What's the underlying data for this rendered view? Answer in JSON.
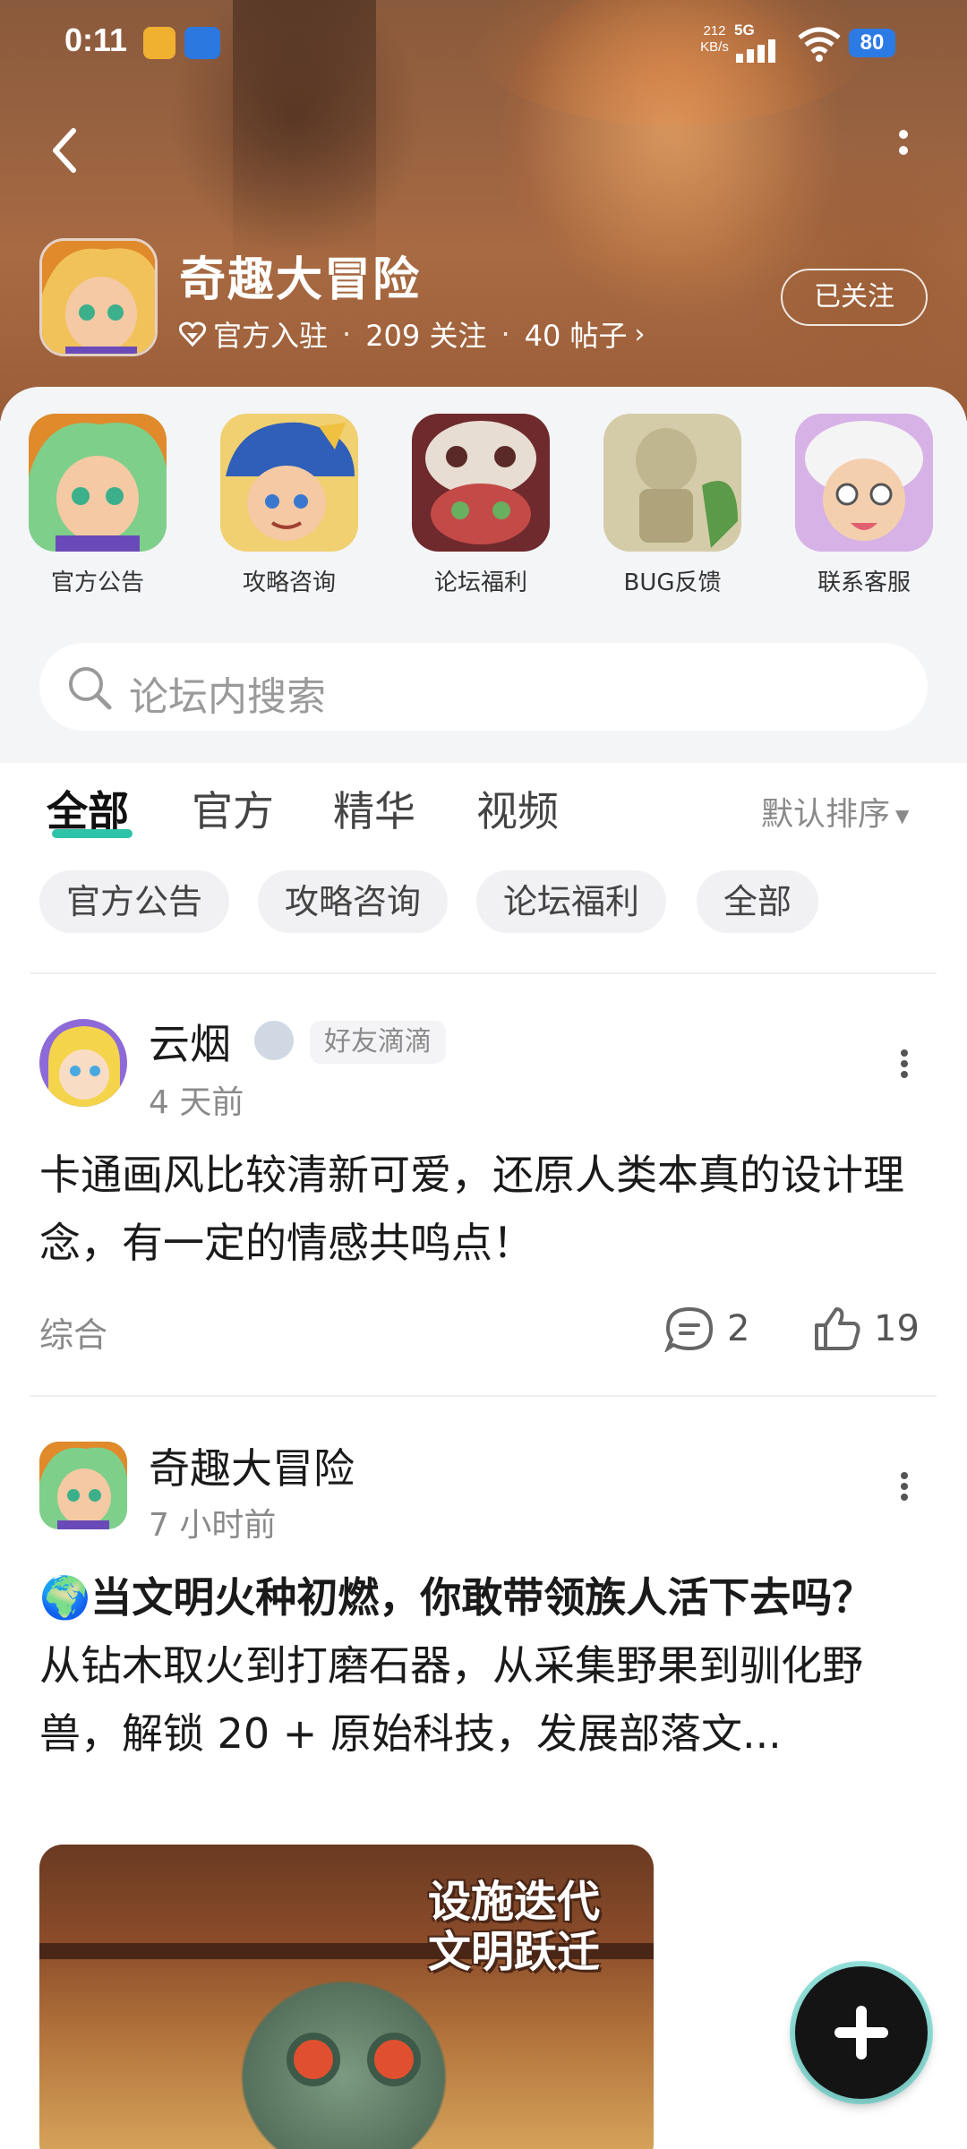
{
  "status_bar": {
    "time": "0:11",
    "network_speed": "212\nKB/s",
    "network_type": "5G",
    "battery": "80"
  },
  "header": {
    "game_title": "奇趣大冒险",
    "verified_label": "官方入驻",
    "followers": "209 关注",
    "posts": "40 帖子",
    "follow_button": "已关注"
  },
  "categories": [
    {
      "label": "官方公告",
      "icon": "character-hero-icon",
      "color": "#e6a04a"
    },
    {
      "label": "攻略咨询",
      "icon": "character-captain-icon",
      "color": "#3a6fc4"
    },
    {
      "label": "论坛福利",
      "icon": "creature-skull-icon",
      "color": "#b04a48"
    },
    {
      "label": "BUG反馈",
      "icon": "statue-icon",
      "color": "#b9b08a"
    },
    {
      "label": "联系客服",
      "icon": "character-scientist-icon",
      "color": "#d9b8e8"
    }
  ],
  "search": {
    "placeholder": "论坛内搜索"
  },
  "tabs": [
    "全部",
    "官方",
    "精华",
    "视频"
  ],
  "active_tab": "全部",
  "sort_label": "默认排序",
  "chips": [
    "官方公告",
    "攻略咨询",
    "论坛福利",
    "全部"
  ],
  "posts": [
    {
      "author": "云烟",
      "friend_tag": "好友滴滴",
      "time": "4 天前",
      "body": "卡通画风比较清新可爱，还原人类本真的设计理念，有一定的情感共鸣点！",
      "tag": "综合",
      "comments": "2",
      "likes": "19"
    },
    {
      "author": "奇趣大冒险",
      "time": "7 小时前",
      "title": "🌍当文明火种初燃，你敢带领族人活下去吗？",
      "body": "从钻木取火到打磨石器，从采集野果到驯化野兽，解锁 20 + 原始科技，发展部落文...",
      "image_caption_line1": "设施迭代",
      "image_caption_line2": "文明跃迁"
    }
  ],
  "colors": {
    "accent": "#2fc3a8",
    "banner": "#9a6341",
    "battery": "#2c7be5"
  }
}
